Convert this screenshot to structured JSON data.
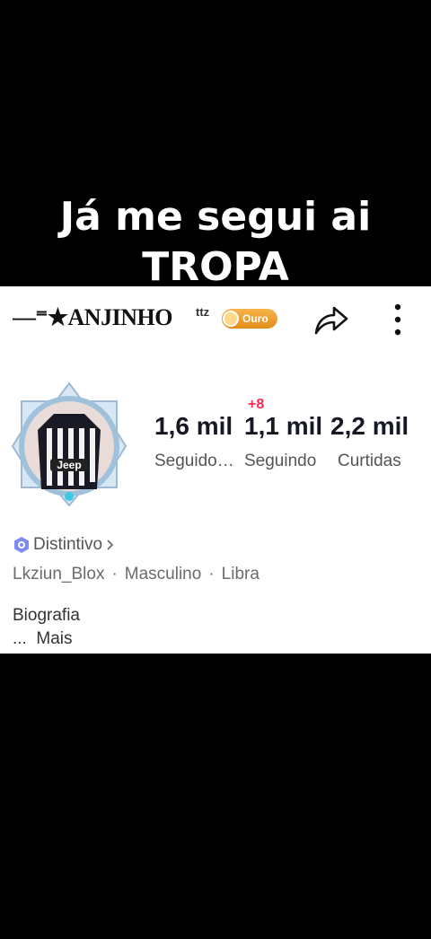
{
  "overlay": {
    "line1": "Já me segui ai",
    "line2": "TROPA"
  },
  "profile": {
    "username": "—⁼★ANJINHO",
    "username_suffix": "ttz",
    "tier_badge": "Ouro",
    "new_followers_badge": "+8",
    "stats": [
      {
        "value": "1,6 mil",
        "label": "Seguido…"
      },
      {
        "value": "1,1 mil",
        "label": "Seguindo"
      },
      {
        "value": "2,2 mil",
        "label": "Curtidas"
      }
    ],
    "badge_link": "Distintivo",
    "details": [
      "Lkziun_Blox",
      "Masculino",
      "Libra"
    ],
    "separator": "·",
    "bio_heading": "Biografia",
    "bio_text": "...",
    "bio_more": "Mais"
  },
  "icons": {
    "share": "share-arrow-icon",
    "more": "more-vertical-icon",
    "badge": "hexagon-badge-icon",
    "chevron": "chevron-right-icon"
  },
  "colors": {
    "accent_red": "#fe2c55",
    "gold": "#e38d1a"
  }
}
